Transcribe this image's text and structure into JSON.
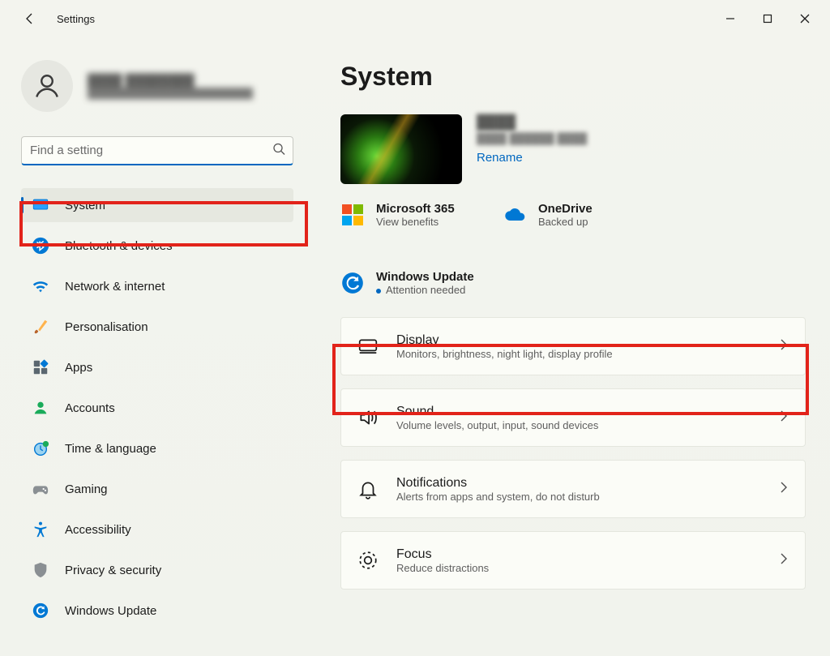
{
  "app": {
    "title": "Settings"
  },
  "user": {
    "name": "████ ████████",
    "email": "████████████████████████"
  },
  "search": {
    "placeholder": "Find a setting"
  },
  "nav": [
    {
      "id": "system",
      "label": "System",
      "active": true
    },
    {
      "id": "bluetooth",
      "label": "Bluetooth & devices",
      "active": false
    },
    {
      "id": "network",
      "label": "Network & internet",
      "active": false
    },
    {
      "id": "personalisation",
      "label": "Personalisation",
      "active": false
    },
    {
      "id": "apps",
      "label": "Apps",
      "active": false
    },
    {
      "id": "accounts",
      "label": "Accounts",
      "active": false
    },
    {
      "id": "time",
      "label": "Time & language",
      "active": false
    },
    {
      "id": "gaming",
      "label": "Gaming",
      "active": false
    },
    {
      "id": "accessibility",
      "label": "Accessibility",
      "active": false
    },
    {
      "id": "privacy",
      "label": "Privacy & security",
      "active": false
    },
    {
      "id": "winupdate",
      "label": "Windows Update",
      "active": false
    }
  ],
  "page": {
    "title": "System",
    "device": {
      "name": "████",
      "model": "████ ██████ ████",
      "rename_label": "Rename"
    }
  },
  "status": {
    "m365": {
      "title": "Microsoft 365",
      "sub": "View benefits"
    },
    "onedrive": {
      "title": "OneDrive",
      "sub": "Backed up"
    },
    "update": {
      "title": "Windows Update",
      "sub": "Attention needed"
    }
  },
  "cards": [
    {
      "id": "display",
      "title": "Display",
      "sub": "Monitors, brightness, night light, display profile"
    },
    {
      "id": "sound",
      "title": "Sound",
      "sub": "Volume levels, output, input, sound devices"
    },
    {
      "id": "notifications",
      "title": "Notifications",
      "sub": "Alerts from apps and system, do not disturb"
    },
    {
      "id": "focus",
      "title": "Focus",
      "sub": "Reduce distractions"
    }
  ]
}
